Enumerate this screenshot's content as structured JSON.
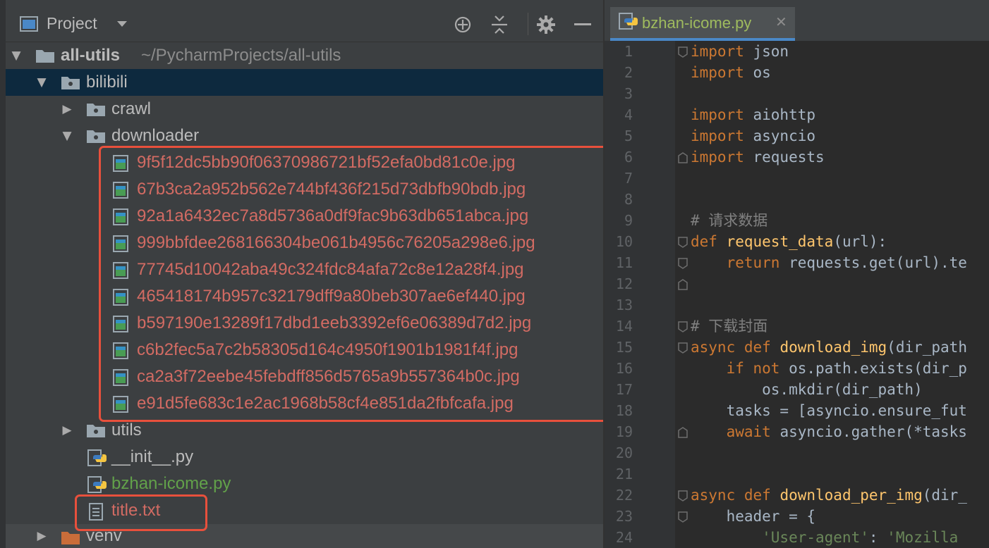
{
  "project_panel": {
    "title": "Project",
    "toolbar": {
      "locate": "crosshair-icon",
      "collapse": "collapse-all-icon",
      "settings": "gear-icon",
      "hide": "minimize-icon"
    }
  },
  "tree": {
    "root": {
      "name": "all-utils",
      "path": "~/PycharmProjects/all-utils"
    },
    "bilibili": "bilibili",
    "crawl": "crawl",
    "downloader": "downloader",
    "images": [
      "9f5f12dc5bb90f06370986721bf52efa0bd81c0e.jpg",
      "67b3ca2a952b562e744bf436f215d73dbfb90bdb.jpg",
      "92a1a6432ec7a8d5736a0df9fac9b63db651abca.jpg",
      "999bbfdee268166304be061b4956c76205a298e6.jpg",
      "77745d10042aba49c324fdc84afa72c8e12a28f4.jpg",
      "465418174b957c32179dff9a80beb307ae6ef440.jpg",
      "b597190e13289f17dbd1eeb3392ef6e06389d7d2.jpg",
      "c6b2fec5a7c2b58305d164c4950f1901b1981f4f.jpg",
      "ca2a3f72eebe45febdff856d5765a9b557364b0c.jpg",
      "e91d5fe683c1e2ac1968b58cf4e851da2fbfcafa.jpg"
    ],
    "utils": "utils",
    "init_file": "__init__.py",
    "main_file": "bzhan-icome.py",
    "title_file": "title.txt",
    "venv": "venv"
  },
  "editor": {
    "tab_label": "bzhan-icome.py",
    "close_glyph": "✕",
    "line_numbers": [
      "1",
      "2",
      "3",
      "4",
      "5",
      "6",
      "7",
      "8",
      "9",
      "10",
      "11",
      "12",
      "13",
      "14",
      "15",
      "16",
      "17",
      "18",
      "19",
      "20",
      "21",
      "22",
      "23",
      "24"
    ],
    "code": {
      "l1_kw": "import",
      "l1_rest": " json",
      "l2_kw": "import",
      "l2_rest": " os",
      "l4_kw": "import",
      "l4_rest": " aiohttp",
      "l5_kw": "import",
      "l5_rest": " asyncio",
      "l6_kw": "import",
      "l6_rest": " requests",
      "l9_comment": "# 请求数据",
      "l10_kw": "def",
      "l10_fn": " request_data",
      "l10_rest": "(url):",
      "l11_kw": "    return",
      "l11_rest": " requests.get(url).te",
      "l14_comment": "# 下载封面",
      "l15_kw": "async def",
      "l15_fn": " download_img",
      "l15_rest": "(dir_path",
      "l16_kw": "    if not",
      "l16_rest": " os.path.exists(dir_p",
      "l17_rest": "        os.mkdir(dir_path)",
      "l18_rest": "    tasks = [asyncio.ensure_fut",
      "l19_kw": "    await",
      "l19_rest": " asyncio.gather(*tasks",
      "l22_kw": "async def",
      "l22_fn": " download_per_img",
      "l22_rest": "(dir_",
      "l23_rest": "    header = {",
      "l24_str1": "        'User-agent'",
      "l24_rest": ": ",
      "l24_str2": "'Mozilla"
    }
  }
}
